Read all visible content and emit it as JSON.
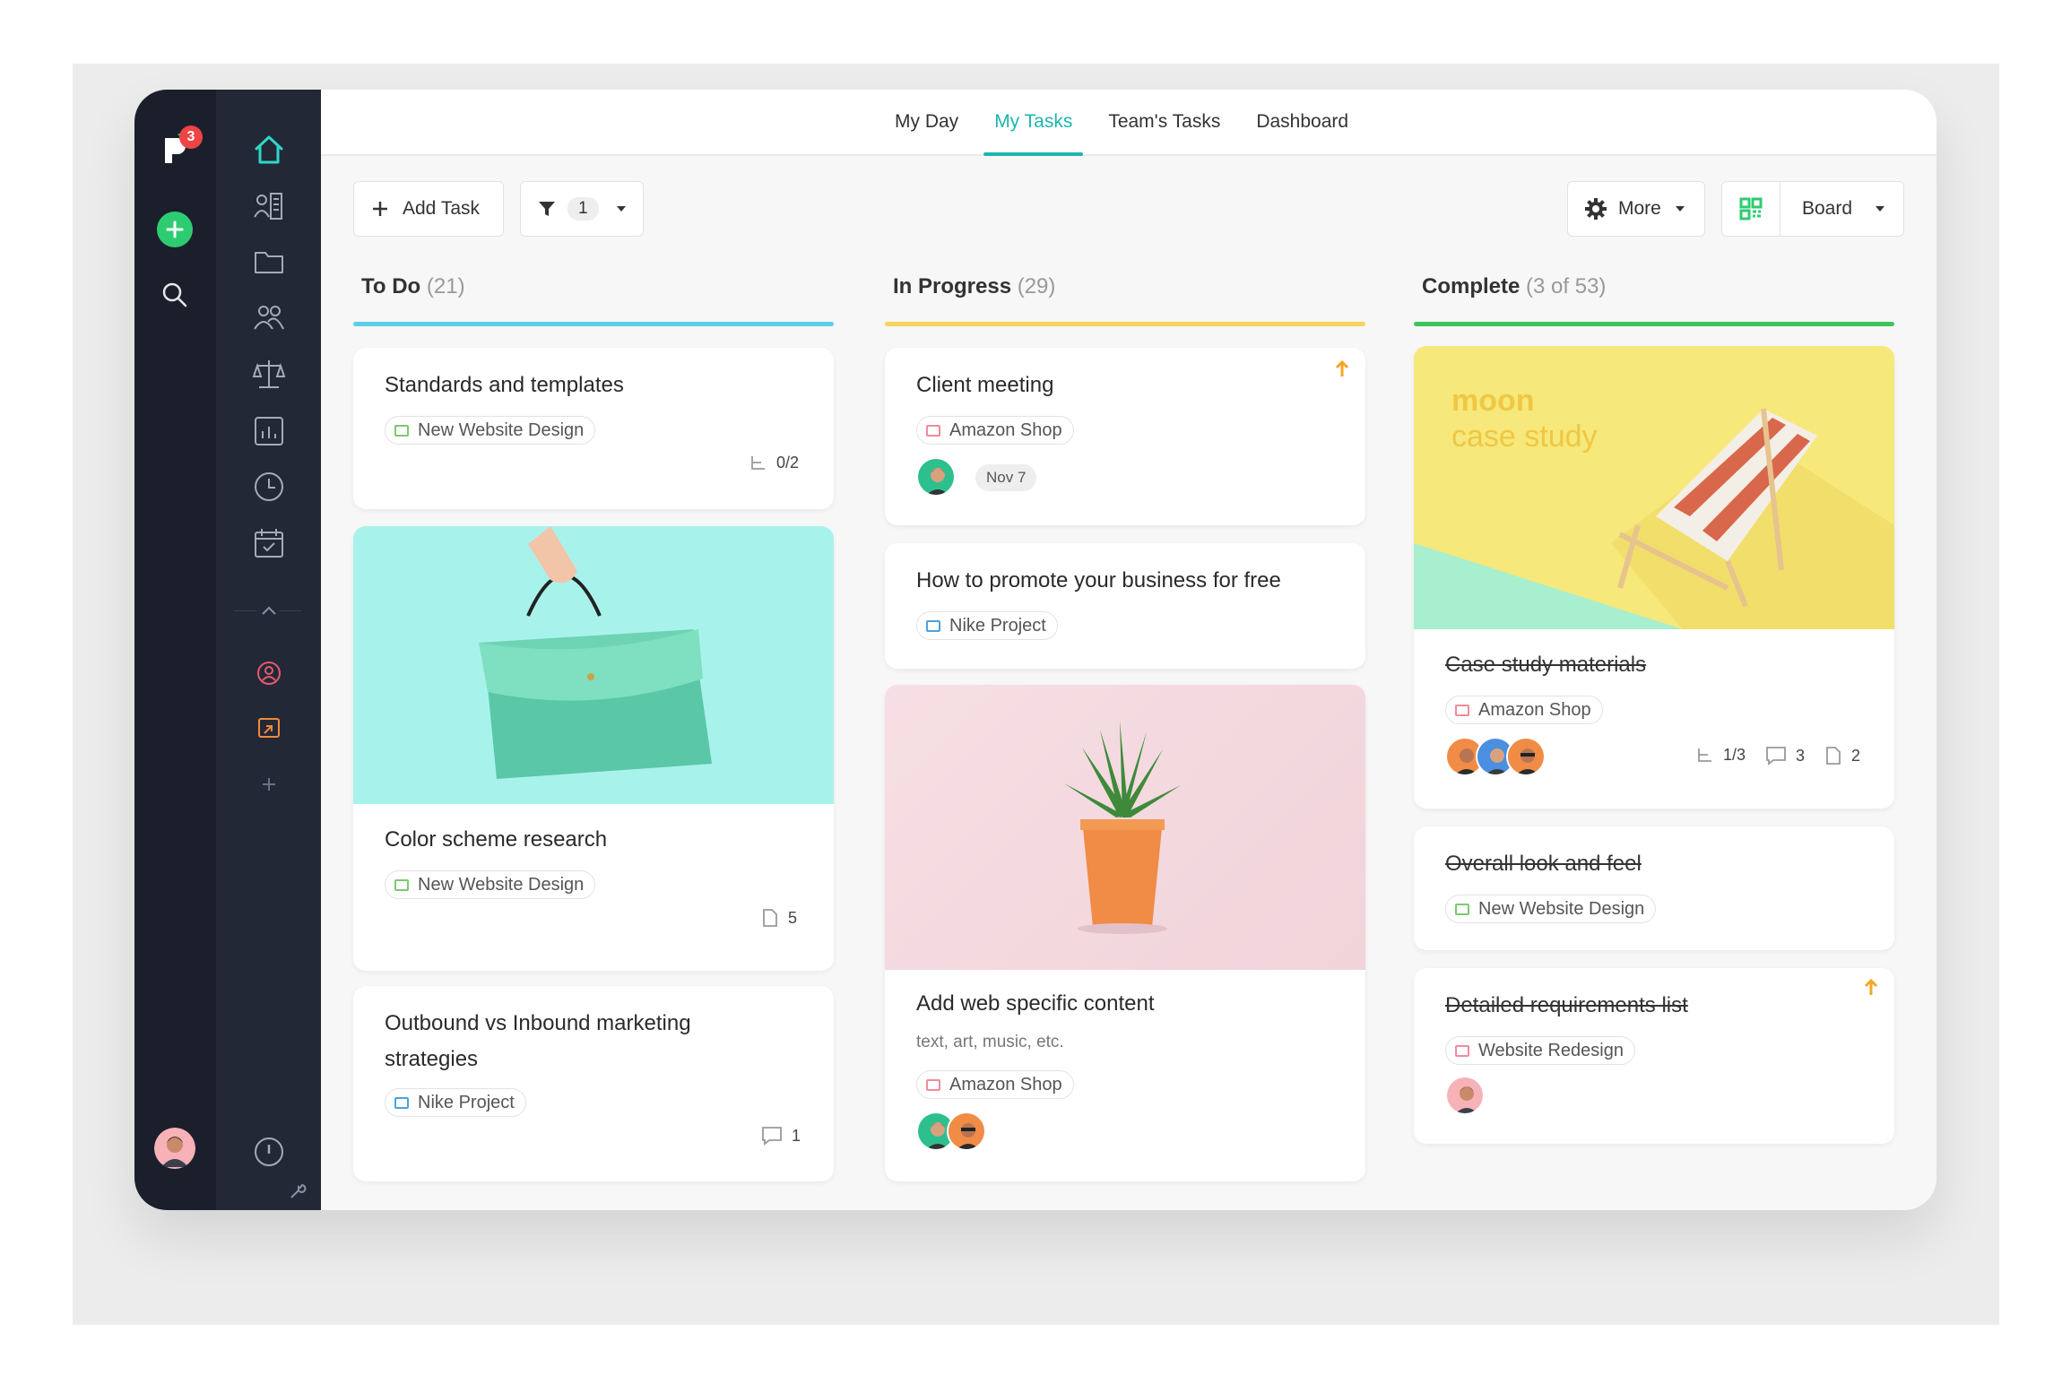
{
  "app": {
    "notification_count": "3"
  },
  "nav": {
    "tabs": [
      {
        "label": "My Day"
      },
      {
        "label": "My Tasks"
      },
      {
        "label": "Team's Tasks"
      },
      {
        "label": "Dashboard"
      }
    ],
    "active_tab": "My Tasks"
  },
  "toolbar": {
    "add_task_label": "Add Task",
    "filter_count": "1",
    "more_label": "More",
    "view_label": "Board"
  },
  "columns": [
    {
      "title": "To Do",
      "count": "(21)",
      "color": "#5bcfe6",
      "cards": [
        {
          "title": "Standards and templates",
          "project": "New Website Design",
          "project_color": "#7bc96f",
          "subtasks": "0/2"
        },
        {
          "title": "Color scheme research",
          "project": "New Website Design",
          "project_color": "#7bc96f",
          "files": "5"
        },
        {
          "title": "Outbound vs Inbound marketing strategies",
          "project": "Nike Project",
          "project_color": "#4aa3df",
          "comments": "1"
        }
      ]
    },
    {
      "title": "In Progress",
      "count": "(29)",
      "color": "#f5d45b",
      "cards": [
        {
          "title": "Client meeting",
          "project": "Amazon Shop",
          "project_color": "#f28b9b",
          "date": "Nov 7",
          "priority": "high"
        },
        {
          "title": "How to promote your business for free",
          "project": "Nike Project",
          "project_color": "#4aa3df"
        },
        {
          "title": "Add web specific content",
          "description": "text, art, music, etc.",
          "project": "Amazon Shop",
          "project_color": "#f28b9b"
        }
      ]
    },
    {
      "title": "Complete",
      "count": "(3 of 53)",
      "color": "#3cc45c",
      "cards": [
        {
          "title": "Case study materials",
          "project": "Amazon Shop",
          "project_color": "#f28b9b",
          "subtasks": "1/3",
          "comments": "3",
          "files": "2",
          "image_text_1": "moon",
          "image_text_2": "case study"
        },
        {
          "title": "Overall look and feel",
          "project": "New Website Design",
          "project_color": "#7bc96f"
        },
        {
          "title": "Detailed requirements list",
          "project": "Website Redesign",
          "project_color": "#f28b9b",
          "priority": "high"
        }
      ]
    }
  ],
  "colors": {
    "accent": "#1fb5b0",
    "sidebar_dark": "#1b1f2b",
    "sidebar_mid": "#232837",
    "add_green": "#2ecc71",
    "priority_orange": "#f5a623"
  },
  "icons": [
    "home-icon",
    "workload-icon",
    "folder-icon",
    "people-icon",
    "balance-icon",
    "reports-icon",
    "clock-icon",
    "calendar-check-icon",
    "user-circle-icon",
    "presentation-icon",
    "plus-icon",
    "info-icon",
    "wrench-icon",
    "search-icon",
    "filter-icon",
    "gear-icon",
    "grid-icon"
  ]
}
